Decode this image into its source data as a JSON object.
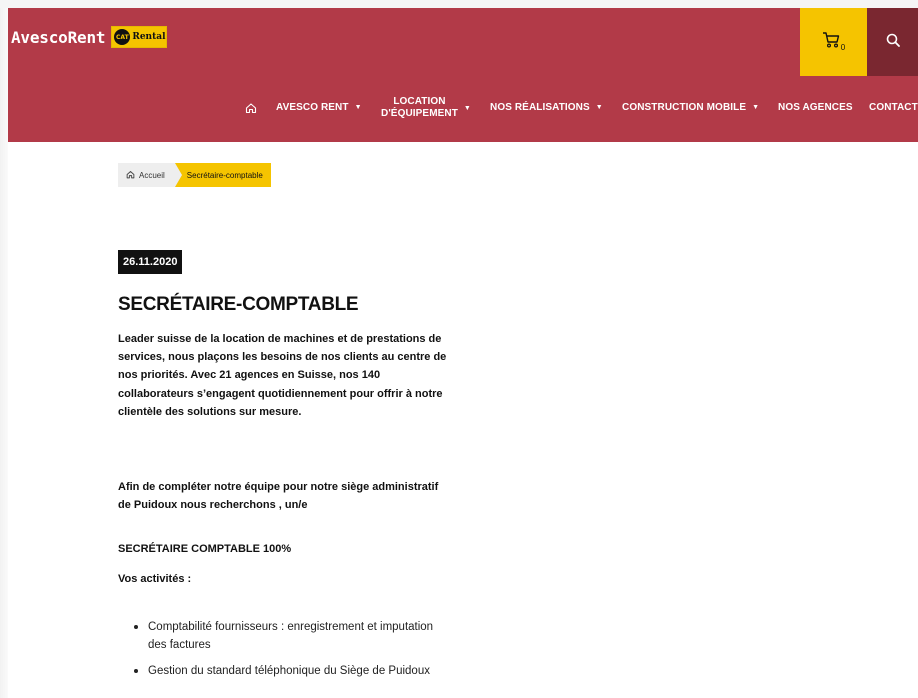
{
  "header": {
    "brand": "AvescoRent",
    "partner_logo_mark": "CAT",
    "partner_logo_text": "Rental",
    "cart_count": "0",
    "accent_color": "#b23a48",
    "yellow_color": "#f5c400"
  },
  "nav": {
    "home_icon": "home-icon",
    "items": [
      {
        "label": "AVESCO RENT"
      },
      {
        "label_line1": "LOCATION",
        "label_line2": "D'ÉQUIPEMENT"
      },
      {
        "label": "NOS RÉALISATIONS"
      },
      {
        "label": "CONSTRUCTION MOBILE"
      },
      {
        "label": "NOS AGENCES"
      },
      {
        "label": "CONTACT"
      }
    ]
  },
  "breadcrumb": {
    "home": "Accueil",
    "current": "Secrétaire-comptable"
  },
  "article": {
    "date": "26.11.2020",
    "title": "SECRÉTAIRE-COMPTABLE",
    "intro": "Leader suisse de la location de machines et de prestations de services, nous plaçons les besoins de nos clients au centre de nos priorités. Avec 21 agences en Suisse, nos 140 collaborateurs s’engagent quotidiennement pour offrir à notre clientèle des solutions sur mesure.",
    "intro2": "Afin de compléter notre équipe pour notre siège administratif de Puidoux nous recherchons , un/e",
    "position": "SECRÉTAIRE COMPTABLE 100%",
    "activities_label": "Vos activités :",
    "tasks": [
      "Comptabilité fournisseurs : enregistrement et imputation des factures",
      "Gestion du standard téléphonique du Siège de Puidoux"
    ]
  }
}
